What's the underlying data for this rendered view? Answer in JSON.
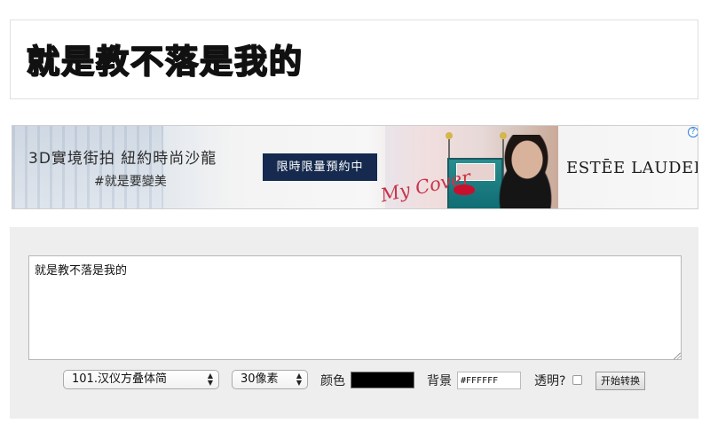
{
  "preview": {
    "text": "就是教不落是我的"
  },
  "ad": {
    "headline": "3D實境街拍  紐約時尚沙龍",
    "hashtag": "#就是要變美",
    "cta_label": "限時限量預約中",
    "script_text": "My Cover",
    "brand": "ESTĒE LAUDER",
    "info_icon": "?"
  },
  "form": {
    "input_text": "就是教不落是我的",
    "font_select": "101.汉仪方叠体简",
    "size_select": "30像素",
    "color_label": "颜色",
    "color_value": "#000000",
    "background_label": "背景",
    "background_value": "#FFFFFF",
    "transparent_label": "透明?",
    "transparent_checked": false,
    "submit_label": "开始转换"
  },
  "icons": {
    "select_arrow": "▲▼"
  }
}
